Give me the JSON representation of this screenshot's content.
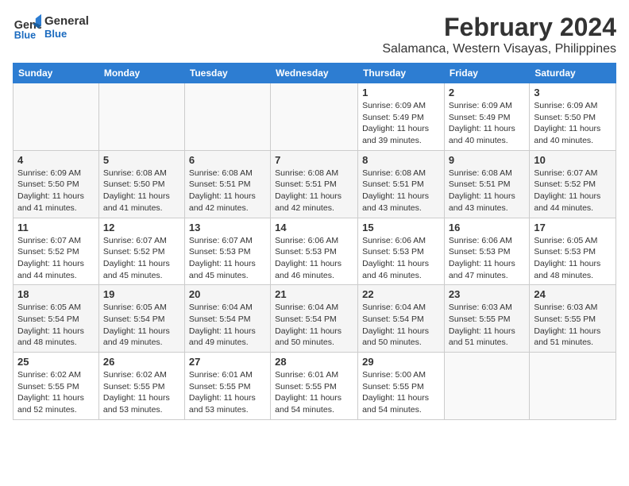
{
  "header": {
    "logo_line1": "General",
    "logo_line2": "Blue",
    "main_title": "February 2024",
    "subtitle": "Salamanca, Western Visayas, Philippines"
  },
  "calendar": {
    "days_of_week": [
      "Sunday",
      "Monday",
      "Tuesday",
      "Wednesday",
      "Thursday",
      "Friday",
      "Saturday"
    ],
    "weeks": [
      [
        {
          "day": "",
          "info": ""
        },
        {
          "day": "",
          "info": ""
        },
        {
          "day": "",
          "info": ""
        },
        {
          "day": "",
          "info": ""
        },
        {
          "day": "1",
          "info": "Sunrise: 6:09 AM\nSunset: 5:49 PM\nDaylight: 11 hours and 39 minutes."
        },
        {
          "day": "2",
          "info": "Sunrise: 6:09 AM\nSunset: 5:49 PM\nDaylight: 11 hours and 40 minutes."
        },
        {
          "day": "3",
          "info": "Sunrise: 6:09 AM\nSunset: 5:50 PM\nDaylight: 11 hours and 40 minutes."
        }
      ],
      [
        {
          "day": "4",
          "info": "Sunrise: 6:09 AM\nSunset: 5:50 PM\nDaylight: 11 hours and 41 minutes."
        },
        {
          "day": "5",
          "info": "Sunrise: 6:08 AM\nSunset: 5:50 PM\nDaylight: 11 hours and 41 minutes."
        },
        {
          "day": "6",
          "info": "Sunrise: 6:08 AM\nSunset: 5:51 PM\nDaylight: 11 hours and 42 minutes."
        },
        {
          "day": "7",
          "info": "Sunrise: 6:08 AM\nSunset: 5:51 PM\nDaylight: 11 hours and 42 minutes."
        },
        {
          "day": "8",
          "info": "Sunrise: 6:08 AM\nSunset: 5:51 PM\nDaylight: 11 hours and 43 minutes."
        },
        {
          "day": "9",
          "info": "Sunrise: 6:08 AM\nSunset: 5:51 PM\nDaylight: 11 hours and 43 minutes."
        },
        {
          "day": "10",
          "info": "Sunrise: 6:07 AM\nSunset: 5:52 PM\nDaylight: 11 hours and 44 minutes."
        }
      ],
      [
        {
          "day": "11",
          "info": "Sunrise: 6:07 AM\nSunset: 5:52 PM\nDaylight: 11 hours and 44 minutes."
        },
        {
          "day": "12",
          "info": "Sunrise: 6:07 AM\nSunset: 5:52 PM\nDaylight: 11 hours and 45 minutes."
        },
        {
          "day": "13",
          "info": "Sunrise: 6:07 AM\nSunset: 5:53 PM\nDaylight: 11 hours and 45 minutes."
        },
        {
          "day": "14",
          "info": "Sunrise: 6:06 AM\nSunset: 5:53 PM\nDaylight: 11 hours and 46 minutes."
        },
        {
          "day": "15",
          "info": "Sunrise: 6:06 AM\nSunset: 5:53 PM\nDaylight: 11 hours and 46 minutes."
        },
        {
          "day": "16",
          "info": "Sunrise: 6:06 AM\nSunset: 5:53 PM\nDaylight: 11 hours and 47 minutes."
        },
        {
          "day": "17",
          "info": "Sunrise: 6:05 AM\nSunset: 5:53 PM\nDaylight: 11 hours and 48 minutes."
        }
      ],
      [
        {
          "day": "18",
          "info": "Sunrise: 6:05 AM\nSunset: 5:54 PM\nDaylight: 11 hours and 48 minutes."
        },
        {
          "day": "19",
          "info": "Sunrise: 6:05 AM\nSunset: 5:54 PM\nDaylight: 11 hours and 49 minutes."
        },
        {
          "day": "20",
          "info": "Sunrise: 6:04 AM\nSunset: 5:54 PM\nDaylight: 11 hours and 49 minutes."
        },
        {
          "day": "21",
          "info": "Sunrise: 6:04 AM\nSunset: 5:54 PM\nDaylight: 11 hours and 50 minutes."
        },
        {
          "day": "22",
          "info": "Sunrise: 6:04 AM\nSunset: 5:54 PM\nDaylight: 11 hours and 50 minutes."
        },
        {
          "day": "23",
          "info": "Sunrise: 6:03 AM\nSunset: 5:55 PM\nDaylight: 11 hours and 51 minutes."
        },
        {
          "day": "24",
          "info": "Sunrise: 6:03 AM\nSunset: 5:55 PM\nDaylight: 11 hours and 51 minutes."
        }
      ],
      [
        {
          "day": "25",
          "info": "Sunrise: 6:02 AM\nSunset: 5:55 PM\nDaylight: 11 hours and 52 minutes."
        },
        {
          "day": "26",
          "info": "Sunrise: 6:02 AM\nSunset: 5:55 PM\nDaylight: 11 hours and 53 minutes."
        },
        {
          "day": "27",
          "info": "Sunrise: 6:01 AM\nSunset: 5:55 PM\nDaylight: 11 hours and 53 minutes."
        },
        {
          "day": "28",
          "info": "Sunrise: 6:01 AM\nSunset: 5:55 PM\nDaylight: 11 hours and 54 minutes."
        },
        {
          "day": "29",
          "info": "Sunrise: 5:00 AM\nSunset: 5:55 PM\nDaylight: 11 hours and 54 minutes."
        },
        {
          "day": "",
          "info": ""
        },
        {
          "day": "",
          "info": ""
        }
      ]
    ]
  }
}
